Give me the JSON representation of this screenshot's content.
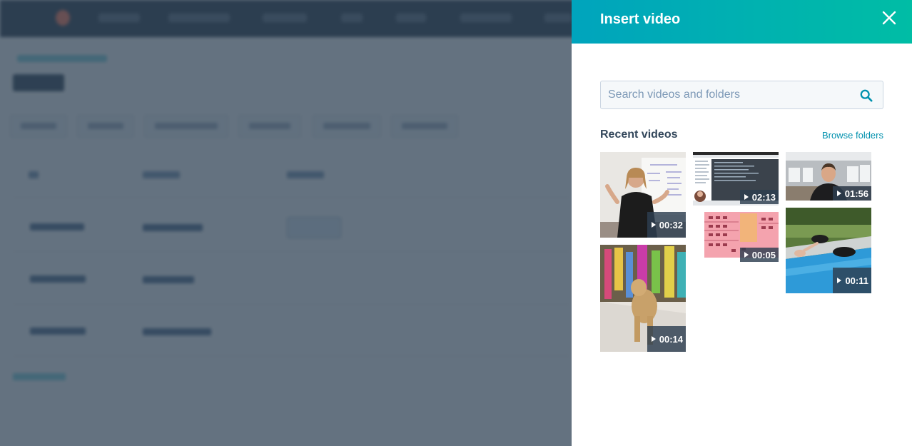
{
  "drawer": {
    "title": "Insert video",
    "close_label": "Close",
    "search": {
      "placeholder": "Search videos and folders",
      "value": ""
    },
    "recent_title": "Recent videos",
    "browse_label": "Browse folders"
  },
  "videos": [
    {
      "duration": "00:32"
    },
    {
      "duration": "00:14"
    },
    {
      "duration": "02:13"
    },
    {
      "duration": "00:05"
    },
    {
      "duration": "01:56"
    },
    {
      "duration": "00:11"
    }
  ],
  "colors": {
    "header_start": "#00a4bd",
    "header_end": "#00bda5",
    "link": "#0091ae",
    "text": "#33475b",
    "overlay": "#2d3e50"
  },
  "icons": [
    "close-icon",
    "search-icon",
    "play-icon"
  ]
}
